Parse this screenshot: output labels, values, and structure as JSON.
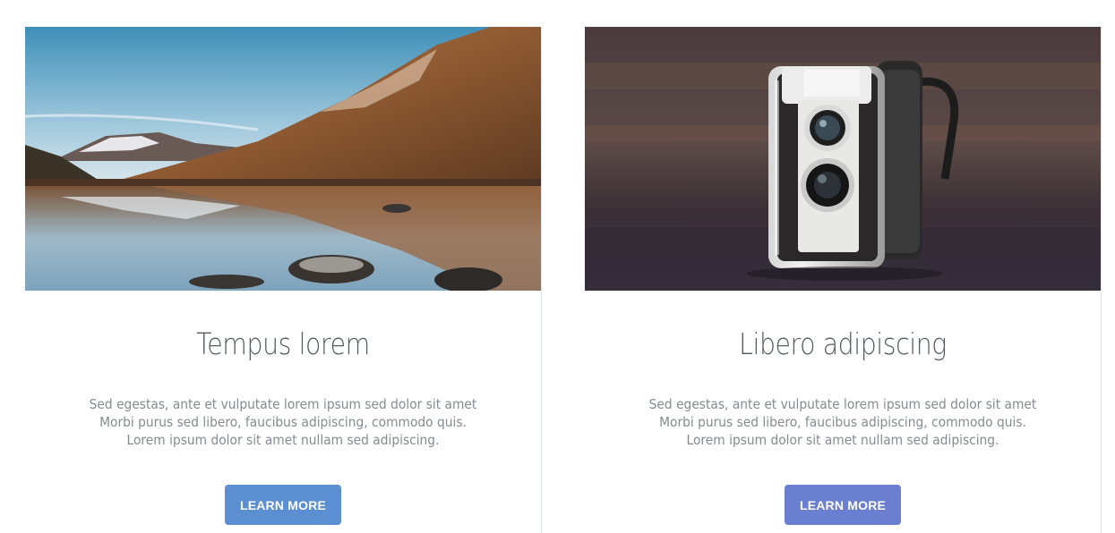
{
  "cards": [
    {
      "title": "Tempus lorem",
      "text_lines": [
        "Sed egestas, ante et vulputate lorem ipsum sed dolor sit amet",
        "Morbi purus sed libero, faucibus adipiscing, commodo quis.",
        "Lorem ipsum dolor sit amet nullam sed adipiscing."
      ],
      "button_label": "LEARN MORE",
      "button_color": "#5b8fd2"
    },
    {
      "title": "Libero adipiscing",
      "text_lines": [
        "Sed egestas, ante et vulputate lorem ipsum sed dolor sit amet",
        "Morbi purus sed libero, faucibus adipiscing, commodo quis.",
        "Lorem ipsum dolor sit amet nullam sed adipiscing."
      ],
      "button_label": "LEARN MORE",
      "button_color": "#6b7fd0"
    }
  ]
}
